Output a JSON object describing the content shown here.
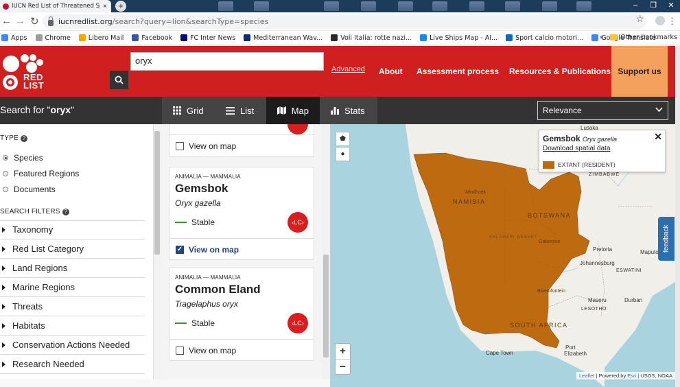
{
  "browser": {
    "tab_title": "IUCN Red List of Threatened Spe",
    "tab_close": "×",
    "new_tab": "+",
    "url_host": "iucnredlist.org",
    "url_path": "/search?query=lion&searchType=species",
    "bookmarks": [
      {
        "label": "Apps",
        "color": "#4285f4"
      },
      {
        "label": "Chrome",
        "color": "#9e9e9e"
      },
      {
        "label": "Libero Mail",
        "color": "#f2a600"
      },
      {
        "label": "Facebook",
        "color": "#3b5998"
      },
      {
        "label": "FC Inter News",
        "color": "#0a0a6e"
      },
      {
        "label": "Mediterranean Wav...",
        "color": "#0f2d6b"
      },
      {
        "label": "Voli Italia: rotte nazi...",
        "color": "#2b2b2b"
      },
      {
        "label": "Live Ships Map - AI...",
        "color": "#1e88e5"
      },
      {
        "label": "Sport calcio motori...",
        "color": "#1565c0"
      },
      {
        "label": "Google Translate",
        "color": "#4285f4"
      }
    ],
    "bookmarks_more": "»",
    "other_bookmarks": "Other bookmarks"
  },
  "header": {
    "logo_text_line1": "RED",
    "logo_text_line2": "LIST",
    "search_value": "oryx",
    "advanced_label": "Advanced",
    "nav": [
      "About",
      "Assessment process",
      "Resources & Publications"
    ],
    "support_label": "Support us"
  },
  "toolbar": {
    "search_prefix": "Search for \"",
    "search_term": "oryx",
    "search_suffix": "\"",
    "views": [
      {
        "label": "Grid",
        "icon": "grid-icon"
      },
      {
        "label": "List",
        "icon": "list-icon"
      },
      {
        "label": "Map",
        "icon": "map-icon"
      },
      {
        "label": "Stats",
        "icon": "stats-icon"
      }
    ],
    "active_view": "Map",
    "sort_value": "Relevance"
  },
  "filters": {
    "type_heading": "TYPE",
    "type_options": [
      {
        "label": "Species",
        "selected": true
      },
      {
        "label": "Featured Regions",
        "selected": false
      },
      {
        "label": "Documents",
        "selected": false
      }
    ],
    "search_filters_heading": "SEARCH FILTERS",
    "items": [
      "Taxonomy",
      "Red List Category",
      "Land Regions",
      "Marine Regions",
      "Threats",
      "Habitats",
      "Conservation Actions Needed",
      "Research Needed"
    ]
  },
  "results": {
    "partial_card": {
      "view_on_map": "View on map",
      "checked": false
    },
    "cards": [
      {
        "kingdom": "ANIMALIA — MAMMALIA",
        "common_name": "Gemsbok",
        "scientific_name": "Oryx gazella",
        "trend": "Stable",
        "category": "LC",
        "view_on_map": "View on map",
        "checked": true
      },
      {
        "kingdom": "ANIMALIA — MAMMALIA",
        "common_name": "Common Eland",
        "scientific_name": "Tragelaphus oryx",
        "trend": "Stable",
        "category": "LC",
        "view_on_map": "View on map",
        "checked": false
      }
    ]
  },
  "map": {
    "popup": {
      "title": "Gemsbok",
      "scientific": "Oryx gazella",
      "download_link": "Download spatial data",
      "legend_label": "EXTANT (RESIDENT)",
      "legend_color": "#bd6a11",
      "close": "✕"
    },
    "range_color": "#bd6a11",
    "labels": {
      "lusaka": "Lusaka",
      "zimbabwe": "ZIMBABWE",
      "namibia": "NAMIBIA",
      "windhoek": "Windhoek",
      "botswana": "BOTSWANA",
      "kalahari": "KALAHARI DESERT",
      "gaborone": "Gaborone",
      "pretoria": "Pretoria",
      "maputo": "Maputo",
      "johannesburg": "Johannesburg",
      "eswatini": "ESWATINI",
      "bloemfontein": "Bloemfontein",
      "maseru": "Maseru",
      "durban": "Durban",
      "lesotho": "LESOTHO",
      "south_africa": "SOUTH AFRICA",
      "cape_town": "Cape Town",
      "port_elizabeth_1": "Port",
      "port_elizabeth_2": "Elizabeth"
    },
    "zoom_in": "+",
    "zoom_out": "−",
    "attribution_leaflet": "Leaflet",
    "attribution_sep": " | Powered by ",
    "attribution_esri": "Esri",
    "attribution_rest": " | USGS, NOAA"
  },
  "feedback_label": "feedback"
}
